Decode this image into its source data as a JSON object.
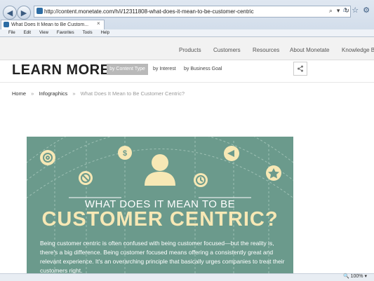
{
  "browser": {
    "url": "http://content.monetate.com/h/i/12311808-what-does-it-mean-to-be-customer-centric",
    "tab_title": "What Does It Mean to Be Custom...",
    "menu": [
      "File",
      "Edit",
      "View",
      "Favorites",
      "Tools",
      "Help"
    ],
    "zoom": "100%"
  },
  "site": {
    "nav": [
      "Products",
      "Customers",
      "Resources",
      "About Monetate",
      "Knowledge B"
    ],
    "heading": "LEARN MORE",
    "filters": [
      "by Content Type",
      "by Interest",
      "by Business Goal"
    ],
    "breadcrumb": {
      "home": "Home",
      "section": "Infographics",
      "current": "What Does It Mean to Be Customer Centric?",
      "separator": "»"
    }
  },
  "infographic": {
    "title_line1": "WHAT DOES IT MEAN TO BE",
    "title_line2": "CUSTOMER CENTRIC?",
    "paragraph": "Being customer centric is often confused with being customer focused—but the reality is, there's a big difference. Being customer focused means offering a consistently great and relevant experience. It's an overarching principle that basically urges companies to treat their customers right.",
    "colors": {
      "background": "#6b9a8c",
      "title_accent": "#f7e8b5",
      "icon": "#f7e8b5"
    }
  }
}
